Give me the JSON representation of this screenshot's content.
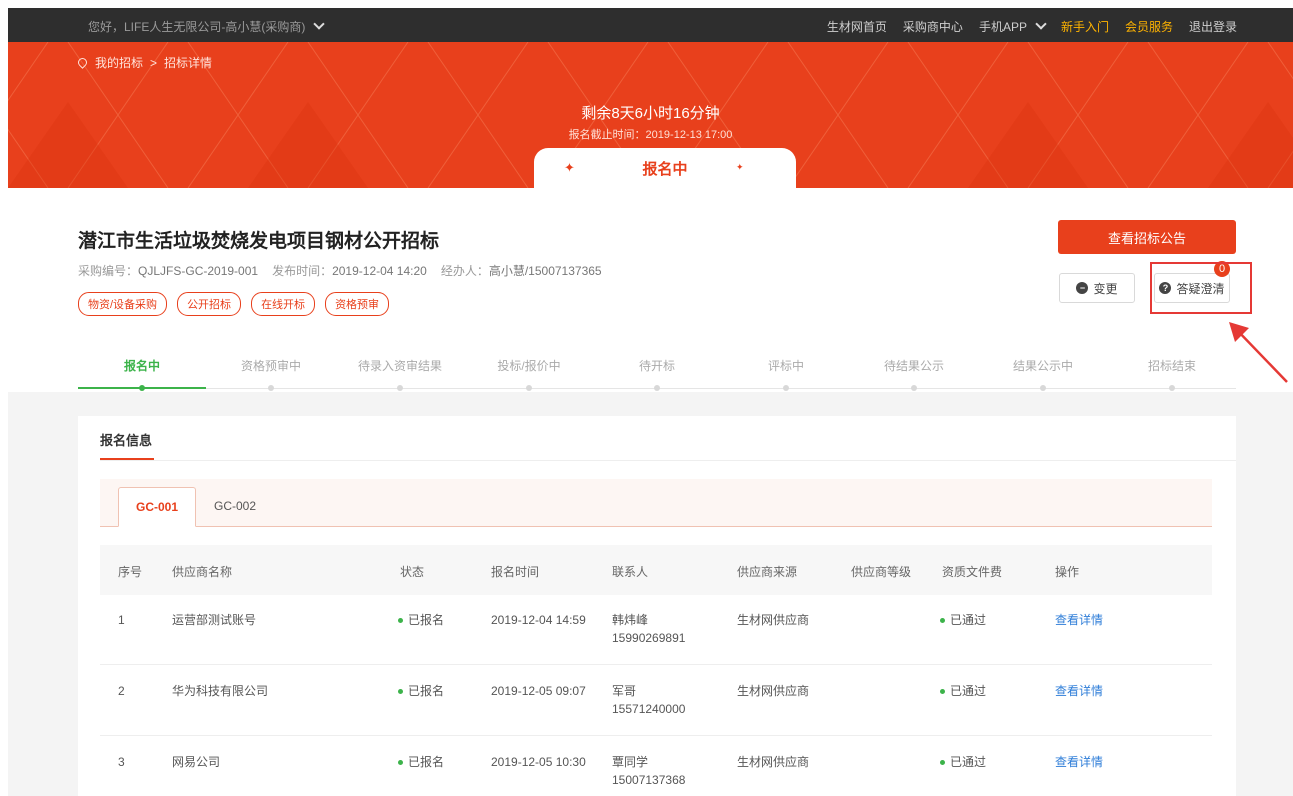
{
  "topbar": {
    "greeting": "您好，LIFE人生无限公司-高小慧(采购商)",
    "links": [
      "生材网首页",
      "采购商中心"
    ],
    "app": "手机APP",
    "newbie": "新手入门",
    "member": "会员服务",
    "logout": "退出登录"
  },
  "breadcrumb": {
    "home": "我的招标",
    "sep": ">",
    "current": "招标详情"
  },
  "hero": {
    "countdown": "剩余8天6小时16分钟",
    "deadline": "报名截止时间：2019-12-13 17:00",
    "status": "报名中"
  },
  "project": {
    "title": "潜江市生活垃圾焚烧发电项目钢材公开招标",
    "code_label": "采购编号：",
    "code": "QJLJFS-GC-2019-001",
    "pub_label": "发布时间：",
    "pub_time": "2019-12-04 14:20",
    "handler_label": "经办人：",
    "handler": "高小慧/15007137365",
    "tags": [
      "物资/设备采购",
      "公开招标",
      "在线开标",
      "资格预审"
    ]
  },
  "actions": {
    "notice": "查看招标公告",
    "change": "变更",
    "qa": "答疑澄清",
    "qa_count": "0"
  },
  "steps": [
    "报名中",
    "资格预审中",
    "待录入资审结果",
    "投标/报价中",
    "待开标",
    "评标中",
    "待结果公示",
    "结果公示中",
    "招标结束"
  ],
  "section": {
    "title": "报名信息",
    "tabs": [
      "GC-001",
      "GC-002"
    ]
  },
  "table": {
    "headers": [
      "序号",
      "供应商名称",
      "状态",
      "报名时间",
      "联系人",
      "供应商来源",
      "供应商等级",
      "资质文件费",
      "操作"
    ],
    "rows": [
      {
        "no": "1",
        "name": "运营部测试账号",
        "status": "已报名",
        "time": "2019-12-04 14:59",
        "contact": "韩炜峰",
        "phone": "15990269891",
        "source": "生材网供应商",
        "level": "",
        "fee": "已通过",
        "action": "查看详情"
      },
      {
        "no": "2",
        "name": "华为科技有限公司",
        "status": "已报名",
        "time": "2019-12-05 09:07",
        "contact": "军哥",
        "phone": "15571240000",
        "source": "生材网供应商",
        "level": "",
        "fee": "已通过",
        "action": "查看详情"
      },
      {
        "no": "3",
        "name": "网易公司",
        "status": "已报名",
        "time": "2019-12-05 10:30",
        "contact": "覃同学",
        "phone": "15007137368",
        "source": "生材网供应商",
        "level": "",
        "fee": "已通过",
        "action": "查看详情"
      }
    ]
  },
  "colors": {
    "brand": "#e8401c",
    "success": "#3cb34a",
    "link": "#2f7ed8",
    "annotation": "#e53935"
  }
}
